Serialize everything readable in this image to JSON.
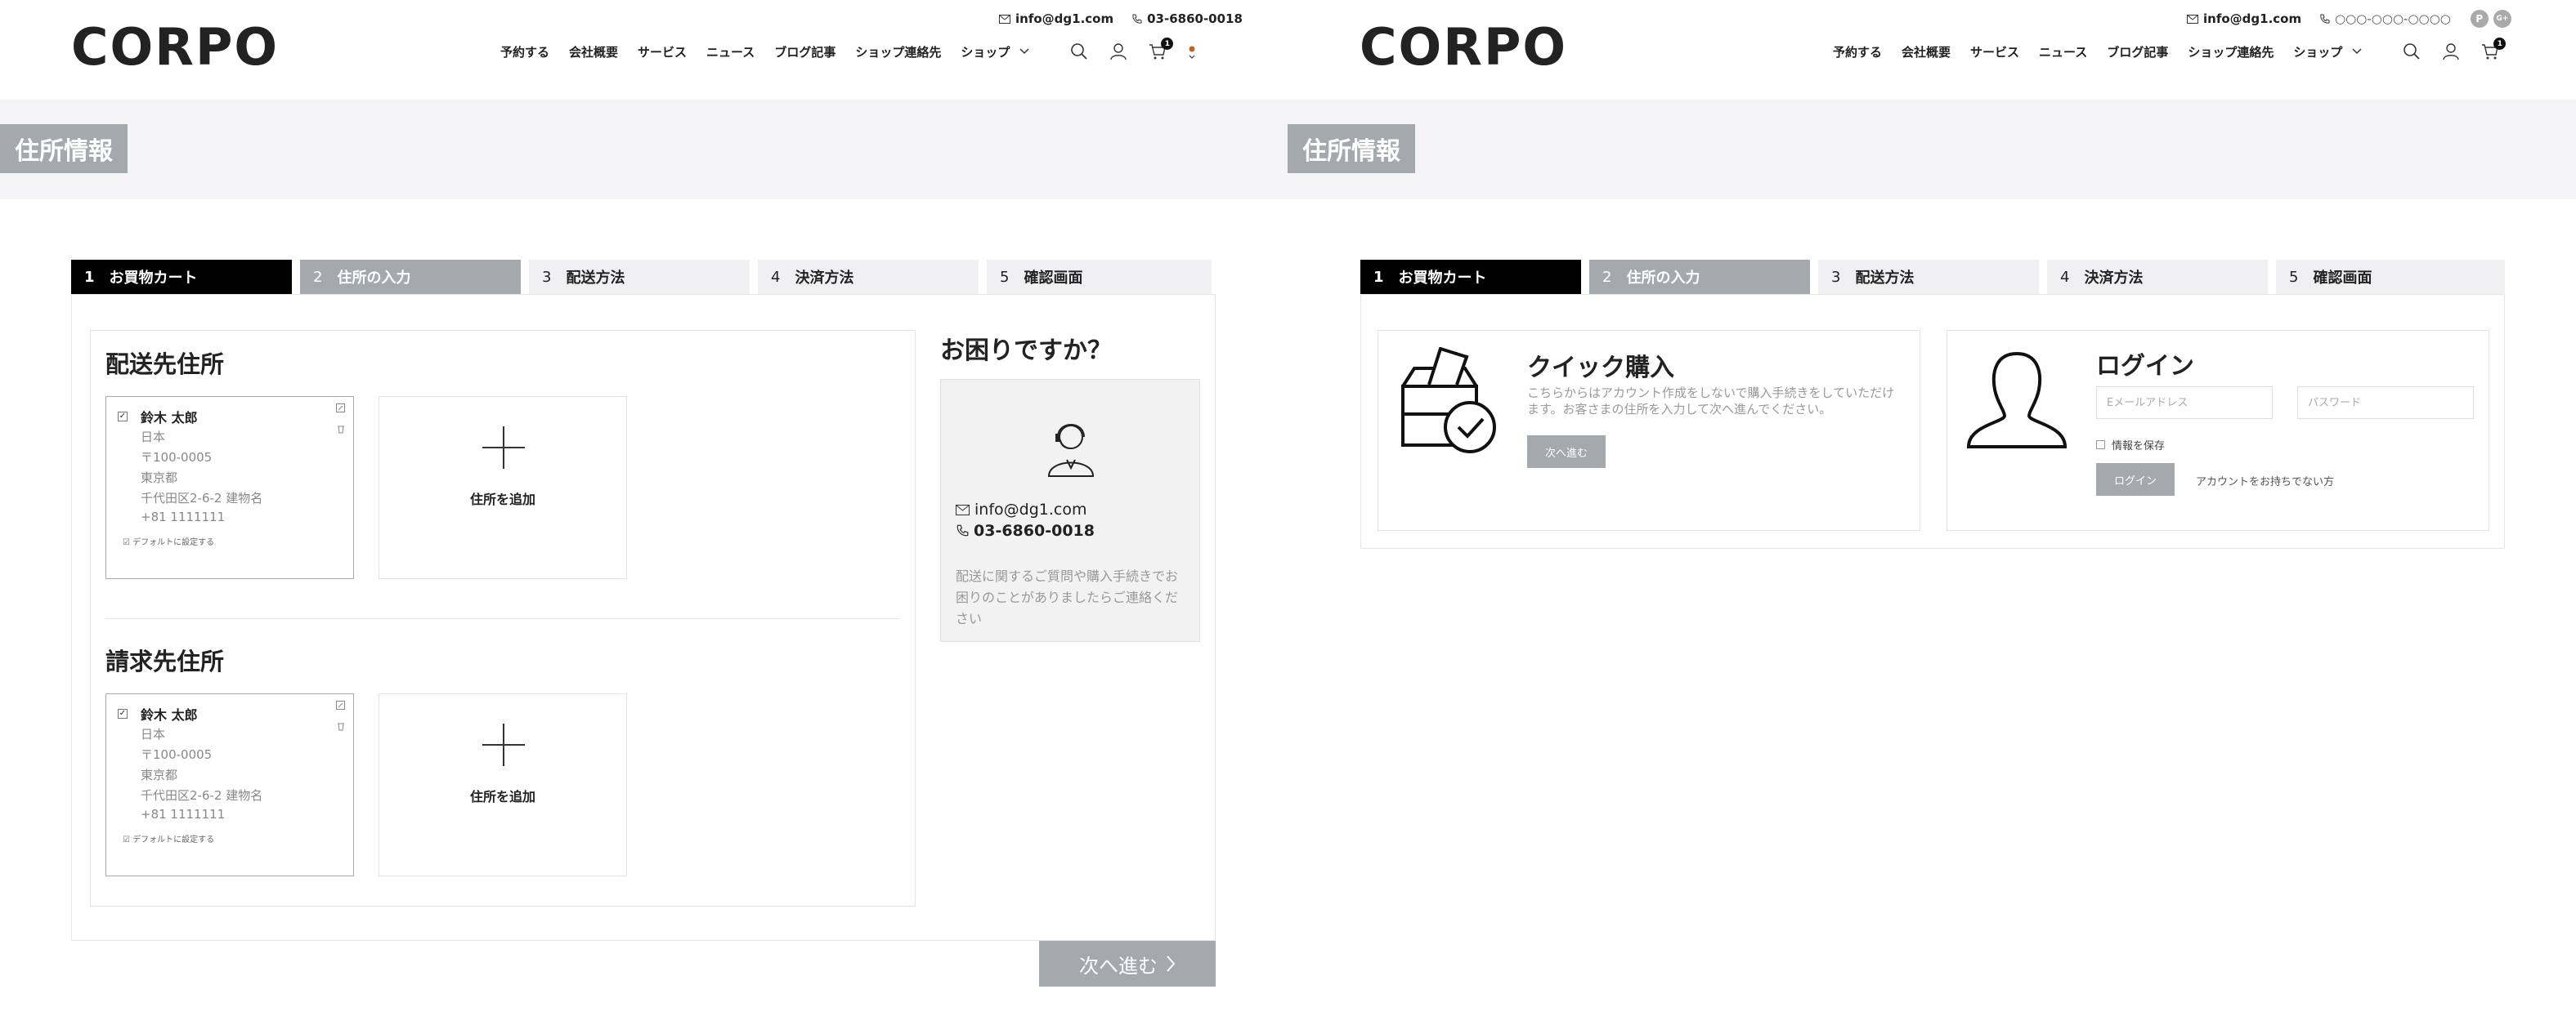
{
  "left": {
    "header": {
      "email": "info@dg1.com",
      "phone": "03-6860-0018",
      "logo": "CORPO",
      "nav": [
        "予約する",
        "会社概要",
        "サービス",
        "ニュース",
        "ブログ記事",
        "ショップ連絡先",
        "ショップ"
      ],
      "cart_count": "1"
    },
    "page_title": "住所情報",
    "steps": [
      {
        "num": "1",
        "label": "お買物カート"
      },
      {
        "num": "2",
        "label": "住所の入力"
      },
      {
        "num": "3",
        "label": "配送方法"
      },
      {
        "num": "4",
        "label": "決済方法"
      },
      {
        "num": "5",
        "label": "確認画面"
      }
    ],
    "shipping": {
      "title": "配送先住所",
      "card": {
        "name": "鈴木 太郎",
        "lines": [
          "日本",
          "〒100-0005",
          "東京都",
          "千代田区2-6-2 建物名",
          "+81 1111111"
        ],
        "default_label": "デフォルトに設定する"
      },
      "add_label": "住所を追加"
    },
    "billing": {
      "title": "請求先住所",
      "card": {
        "name": "鈴木 太郎",
        "lines": [
          "日本",
          "〒100-0005",
          "東京都",
          "千代田区2-6-2 建物名",
          "+81 1111111"
        ],
        "default_label": "デフォルトに設定する"
      },
      "add_label": "住所を追加"
    },
    "help": {
      "title": "お困りですか？",
      "email": "info@dg1.com",
      "phone": "03-6860-0018",
      "description": "配送に関するご質問や購入手続きでお困りのことがありましたらご連絡ください"
    },
    "next_label": "次へ進む"
  },
  "right": {
    "header": {
      "email": "info@dg1.com",
      "phone": "○○○-○○○-○○○○",
      "logo": "CORPO",
      "nav": [
        "予約する",
        "会社概要",
        "サービス",
        "ニュース",
        "ブログ記事",
        "ショップ連絡先",
        "ショップ"
      ],
      "cart_count": "1",
      "social": [
        "P",
        "G+"
      ]
    },
    "page_title": "住所情報",
    "steps": [
      {
        "num": "1",
        "label": "お買物カート"
      },
      {
        "num": "2",
        "label": "住所の入力"
      },
      {
        "num": "3",
        "label": "配送方法"
      },
      {
        "num": "4",
        "label": "決済方法"
      },
      {
        "num": "5",
        "label": "確認画面"
      }
    ],
    "quick": {
      "title": "クイック購入",
      "description": "こちらからはアカウント作成をしないで購入手続きをしていただけます。お客さまの住所を入力して次へ進んでください。",
      "button": "次へ進む"
    },
    "login": {
      "title": "ログイン",
      "email_placeholder": "Eメールアドレス",
      "password_placeholder": "パスワード",
      "remember": "情報を保存",
      "button": "ログイン",
      "no_account": "アカウントをお持ちでない方"
    }
  }
}
